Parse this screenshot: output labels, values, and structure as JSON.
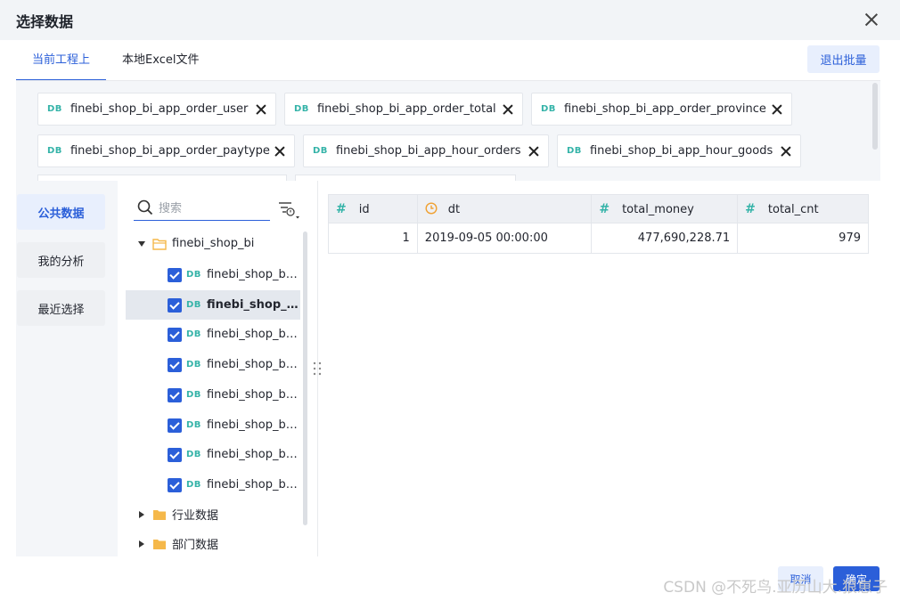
{
  "dialog": {
    "title": "选择数据"
  },
  "tabs": [
    "当前工程上",
    "本地Excel文件"
  ],
  "exit_batch_label": "退出批量",
  "db_badge": "DB",
  "selected_tables": [
    "finebi_shop_bi_app_order_user",
    "finebi_shop_bi_app_order_total",
    "finebi_shop_bi_app_order_province",
    "finebi_shop_bi_app_order_paytype",
    "finebi_shop_bi_app_hour_orders",
    "finebi_shop_bi_app_hour_goods"
  ],
  "nav": [
    "公共数据",
    "我的分析",
    "最近选择"
  ],
  "search": {
    "placeholder": "搜索"
  },
  "tree": {
    "root": "finebi_shop_bi",
    "children": [
      "finebi_shop_bi...",
      "finebi_shop_b...",
      "finebi_shop_bi...",
      "finebi_shop_bi...",
      "finebi_shop_bi...",
      "finebi_shop_bi...",
      "finebi_shop_bi...",
      "finebi_shop_bi..."
    ],
    "folders": [
      "行业数据",
      "部门数据"
    ]
  },
  "preview": {
    "columns": [
      "id",
      "dt",
      "total_money",
      "total_cnt"
    ],
    "rows": [
      [
        "1",
        "2019-09-05 00:00:00",
        "477,690,228.71",
        "979"
      ]
    ]
  },
  "footer": {
    "cancel": "取消",
    "ok": "确定"
  },
  "watermark": "CSDN @不死鸟.亚历山大.狼崽子",
  "colors": {
    "accent": "#2b5fd9",
    "db_badge": "#34b3a8",
    "date_icon": "#f0a030",
    "folder": "#f5b84a"
  }
}
